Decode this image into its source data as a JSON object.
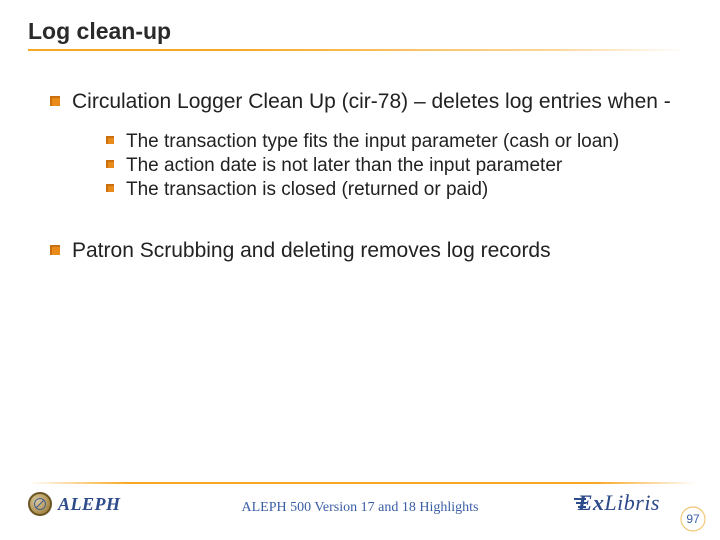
{
  "title": "Log clean-up",
  "bullets": {
    "main1": "Circulation Logger Clean Up (cir-78) – deletes log entries when -",
    "sub1": "The transaction type fits the input parameter (cash or loan)",
    "sub2": "The action date is not later than the input parameter",
    "sub3": "The transaction is closed (returned or paid)",
    "main2": "Patron Scrubbing and deleting removes log records"
  },
  "footer": {
    "caption": "ALEPH 500 Version 17 and 18 Highlights",
    "aleph": "ALEPH",
    "exlibris_ex": "Ex",
    "exlibris_libris": "Libris",
    "page": "97"
  }
}
